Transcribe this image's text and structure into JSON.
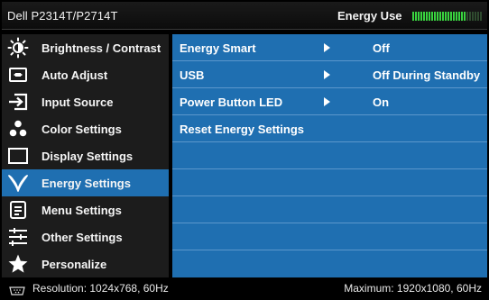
{
  "title": {
    "model": "Dell P2314T/P2714T",
    "energy_label": "Energy Use",
    "energy_level": 0.75
  },
  "colors": {
    "accent": "#1f6fb1",
    "sidebar_bg": "#1c1c1c",
    "meter_on": "#39d43f"
  },
  "sidebar": {
    "items": [
      {
        "label": "Brightness / Contrast",
        "icon": "brightness-icon"
      },
      {
        "label": "Auto Adjust",
        "icon": "auto-adjust-icon"
      },
      {
        "label": "Input Source",
        "icon": "input-source-icon"
      },
      {
        "label": "Color Settings",
        "icon": "color-settings-icon"
      },
      {
        "label": "Display Settings",
        "icon": "display-settings-icon"
      },
      {
        "label": "Energy Settings",
        "icon": "energy-leaf-icon",
        "active": true
      },
      {
        "label": "Menu Settings",
        "icon": "menu-settings-icon"
      },
      {
        "label": "Other Settings",
        "icon": "other-settings-icon"
      },
      {
        "label": "Personalize",
        "icon": "star-icon"
      }
    ]
  },
  "main": {
    "rows": [
      {
        "label": "Energy Smart",
        "value": "Off"
      },
      {
        "label": "USB",
        "value": "Off During Standby"
      },
      {
        "label": "Power Button LED",
        "value": "On"
      },
      {
        "label": "Reset Energy Settings",
        "value": ""
      }
    ]
  },
  "footer": {
    "resolution": "Resolution:  1024x768, 60Hz",
    "maximum": "Maximum: 1920x1080, 60Hz"
  }
}
